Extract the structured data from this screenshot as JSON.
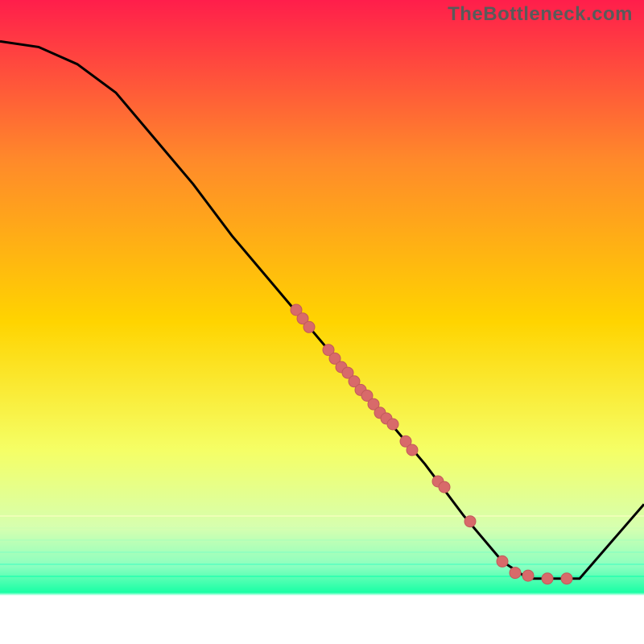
{
  "attribution": "TheBottleneck.com",
  "colors": {
    "top": "#ff1e4b",
    "mid_upper": "#ff8a2a",
    "mid": "#ffd400",
    "mid_lower": "#f5ff66",
    "low1": "#d6ffb0",
    "low2": "#8affc0",
    "bottom": "#19ffa5",
    "baseline": "#ffffff",
    "curve_stroke": "#000000",
    "dot_fill": "#d86a6a",
    "dot_stroke": "#c25a5a"
  },
  "chart_data": {
    "type": "line",
    "title": "",
    "xlabel": "",
    "ylabel": "",
    "xlim": [
      0,
      100
    ],
    "ylim": [
      0,
      100
    ],
    "curve": [
      {
        "x": 0,
        "y": 97
      },
      {
        "x": 6,
        "y": 96
      },
      {
        "x": 12,
        "y": 93
      },
      {
        "x": 18,
        "y": 88
      },
      {
        "x": 24,
        "y": 80
      },
      {
        "x": 30,
        "y": 72
      },
      {
        "x": 36,
        "y": 63
      },
      {
        "x": 42,
        "y": 55
      },
      {
        "x": 48,
        "y": 47
      },
      {
        "x": 54,
        "y": 39
      },
      {
        "x": 60,
        "y": 31
      },
      {
        "x": 66,
        "y": 23
      },
      {
        "x": 72,
        "y": 14
      },
      {
        "x": 78,
        "y": 6
      },
      {
        "x": 82,
        "y": 3
      },
      {
        "x": 86,
        "y": 3
      },
      {
        "x": 90,
        "y": 3
      },
      {
        "x": 100,
        "y": 16
      }
    ],
    "dots": [
      {
        "x": 46,
        "y": 50
      },
      {
        "x": 47,
        "y": 48.5
      },
      {
        "x": 48,
        "y": 47
      },
      {
        "x": 51,
        "y": 43
      },
      {
        "x": 52,
        "y": 41.5
      },
      {
        "x": 53,
        "y": 40
      },
      {
        "x": 54,
        "y": 39
      },
      {
        "x": 55,
        "y": 37.5
      },
      {
        "x": 56,
        "y": 36
      },
      {
        "x": 57,
        "y": 35
      },
      {
        "x": 58,
        "y": 33.5
      },
      {
        "x": 59,
        "y": 32
      },
      {
        "x": 60,
        "y": 31
      },
      {
        "x": 61,
        "y": 30
      },
      {
        "x": 63,
        "y": 27
      },
      {
        "x": 64,
        "y": 25.5
      },
      {
        "x": 68,
        "y": 20
      },
      {
        "x": 69,
        "y": 19
      },
      {
        "x": 73,
        "y": 13
      },
      {
        "x": 78,
        "y": 6
      },
      {
        "x": 80,
        "y": 4
      },
      {
        "x": 82,
        "y": 3.5
      },
      {
        "x": 85,
        "y": 3
      },
      {
        "x": 88,
        "y": 3
      }
    ]
  }
}
